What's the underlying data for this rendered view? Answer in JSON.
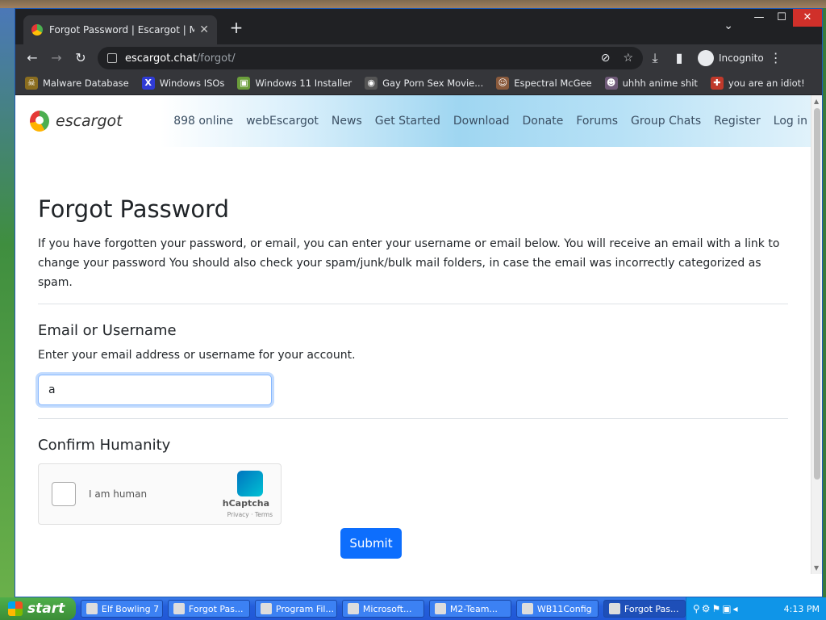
{
  "browser": {
    "tab": {
      "title": "Forgot Password | Escargot | MSN",
      "close": "✕"
    },
    "new_tab": "+",
    "tab_search": "⌄",
    "window_controls": {
      "minimize": "—",
      "maximize": "☐",
      "close": "✕"
    },
    "nav": {
      "back": "←",
      "forward": "→",
      "reload": "↻"
    },
    "url_host": "escargot.chat",
    "url_path": "/forgot/",
    "omni_icons": {
      "eye_off": "⊘",
      "bookmark": "☆",
      "download": "⤓",
      "sidebar": "▮",
      "menu": "⋮"
    },
    "incognito_label": "Incognito",
    "bookmarks": [
      {
        "label": "Malware Database",
        "icon": "skull-icon",
        "color": "#8a6d1f",
        "glyph": "☠"
      },
      {
        "label": "Windows ISOs",
        "icon": "x-icon",
        "color": "#2f3bd6",
        "glyph": "X"
      },
      {
        "label": "Windows 11 Installer",
        "icon": "installer-icon",
        "color": "#6b9e3b",
        "glyph": "▣"
      },
      {
        "label": "Gay Porn Sex Movie...",
        "icon": "film-icon",
        "color": "#555555",
        "glyph": "◉"
      },
      {
        "label": "Espectral McGee",
        "icon": "avatar-icon",
        "color": "#8a5a3c",
        "glyph": "☺"
      },
      {
        "label": "uhhh anime shit",
        "icon": "anime-icon",
        "color": "#6f5a78",
        "glyph": "☻"
      },
      {
        "label": "you are an idiot!",
        "icon": "flag-icon",
        "color": "#c0392b",
        "glyph": "✚"
      }
    ]
  },
  "site": {
    "brand": "escargot",
    "nav_links": [
      "898 online",
      "webEscargot",
      "News",
      "Get Started",
      "Download",
      "Donate",
      "Forums",
      "Group Chats",
      "Register",
      "Log in"
    ]
  },
  "form": {
    "title": "Forgot Password",
    "intro": "If you have forgotten your password, or email, you can enter your username or email below. You will receive an email with a link to change your password You should also check your spam/junk/bulk mail folders, in case the email was incorrectly categorized as spam.",
    "email_heading": "Email or Username",
    "email_help": "Enter your email address or username for your account.",
    "email_value": "a",
    "humanity_heading": "Confirm Humanity",
    "captcha_label": "I am human",
    "captcha_brand": "hCaptcha",
    "captcha_links": "Privacy · Terms",
    "submit": "Submit"
  },
  "taskbar": {
    "start": "start",
    "tasks": [
      {
        "label": "Elf Bowling 7",
        "active": false
      },
      {
        "label": "Forgot Pas...",
        "active": false
      },
      {
        "label": "Program Fil...",
        "active": false
      },
      {
        "label": "Microsoft...",
        "active": false
      },
      {
        "label": "M2-Team...",
        "active": false
      },
      {
        "label": "WB11Config",
        "active": false
      },
      {
        "label": "Forgot Pas...",
        "active": true
      }
    ],
    "clock": "4:13 PM"
  }
}
